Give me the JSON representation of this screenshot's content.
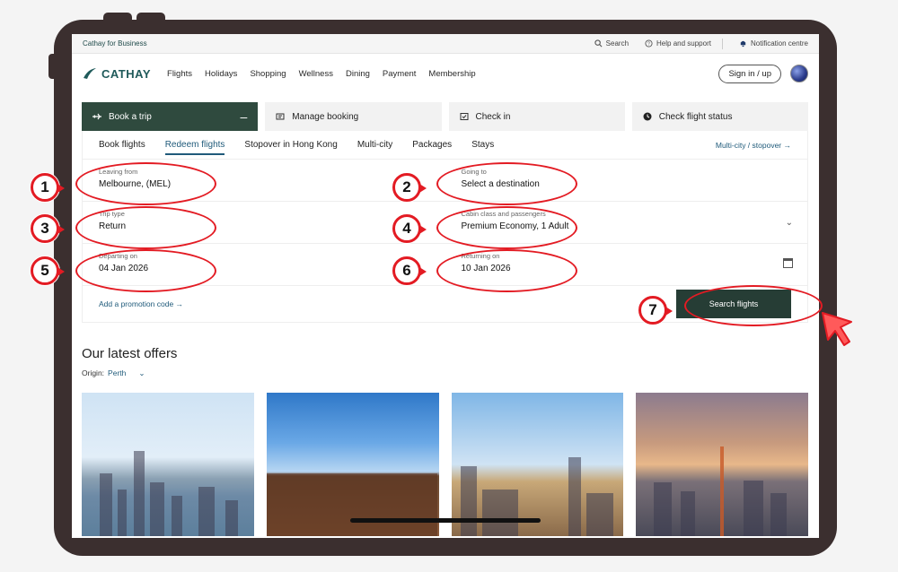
{
  "util_bar": {
    "business": "Cathay for Business",
    "search": "Search",
    "help": "Help and support",
    "notifications": "Notification centre"
  },
  "header": {
    "brand": "CATHAY",
    "nav": [
      "Flights",
      "Holidays",
      "Shopping",
      "Wellness",
      "Dining",
      "Payment",
      "Membership"
    ],
    "signin": "Sign in / up"
  },
  "booking_tabs": [
    {
      "label": "Book a trip",
      "icon": "plane-icon"
    },
    {
      "label": "Manage booking",
      "icon": "manage-icon"
    },
    {
      "label": "Check in",
      "icon": "checkin-icon"
    },
    {
      "label": "Check flight status",
      "icon": "clock-icon"
    }
  ],
  "sub_tabs": [
    "Book flights",
    "Redeem flights",
    "Stopover in Hong Kong",
    "Multi-city",
    "Packages",
    "Stays"
  ],
  "multi_city_link": "Multi-city / stopover →",
  "form": {
    "leaving_label": "Leaving from",
    "leaving_value": "Melbourne, (MEL)",
    "going_label": "Going to",
    "going_value": "Select a destination",
    "trip_label": "Trip type",
    "trip_value": "Return",
    "cabin_label": "Cabin class and passengers",
    "cabin_value": "Premium Economy, 1 Adult",
    "depart_label": "Departing on",
    "depart_value": "04 Jan 2026",
    "return_label": "Returning on",
    "return_value": "10 Jan 2026",
    "promo": "Add a promotion code →",
    "search": "Search flights"
  },
  "offers": {
    "title": "Our latest offers",
    "origin_label": "Origin:",
    "origin_value": "Perth"
  },
  "annotations": [
    "1",
    "2",
    "3",
    "4",
    "5",
    "6",
    "7"
  ],
  "colors": {
    "accent": "#e31b23",
    "brand_green": "#2f4a3e",
    "link": "#1f5a7a"
  }
}
